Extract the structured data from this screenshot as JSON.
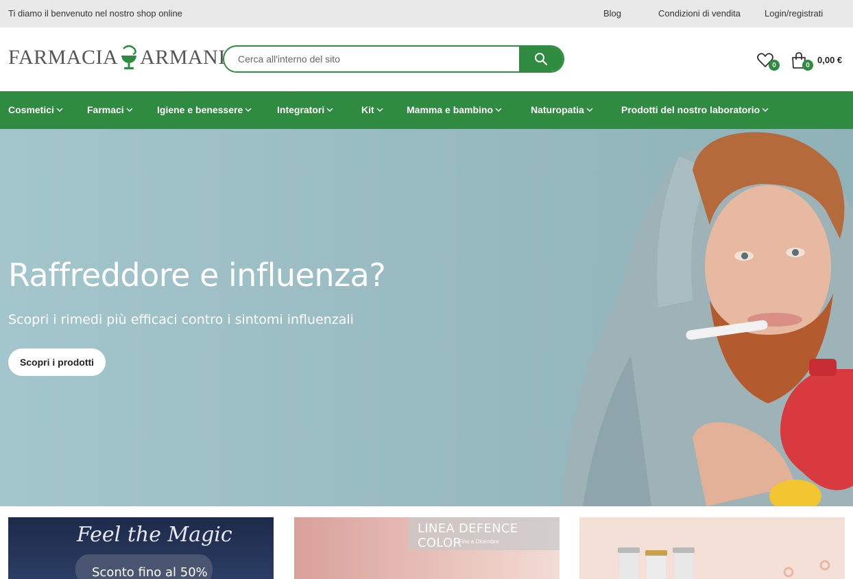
{
  "topbar": {
    "welcome": "Ti diamo il benvenuto nel nostro shop online",
    "links": [
      "Blog",
      "Condizioni di vendita",
      "Login/registrati"
    ]
  },
  "header": {
    "logo_left": "FARMACIA",
    "logo_right": "ARMANI",
    "search_placeholder": "Cerca all'interno del sito",
    "wishlist_count": "0",
    "cart_count": "0",
    "cart_total": "0,00 €"
  },
  "nav": {
    "items": [
      "Cosmetici",
      "Farmaci",
      "Igiene e benessere",
      "Integratori",
      "Kit",
      "Mamma e bambino",
      "Naturopatia",
      "Prodotti del nostro laboratorio"
    ]
  },
  "hero": {
    "title": "Raffreddore e influenza?",
    "subtitle": "Scopri i rimedi più efficaci contro i sintomi influenzali",
    "cta": "Scopri i prodotti"
  },
  "promos": {
    "p1_title": "Feel the Magic",
    "p1_offer": "Sconto fino al 50%",
    "p2_title": "LINEA DEFENCE COLOR",
    "p2_sub": "Fino a Dicembre"
  },
  "colors": {
    "brand_green": "#2e8b3f",
    "topbar_bg": "#e9e9e9",
    "hero_bg": "#97bac0"
  }
}
